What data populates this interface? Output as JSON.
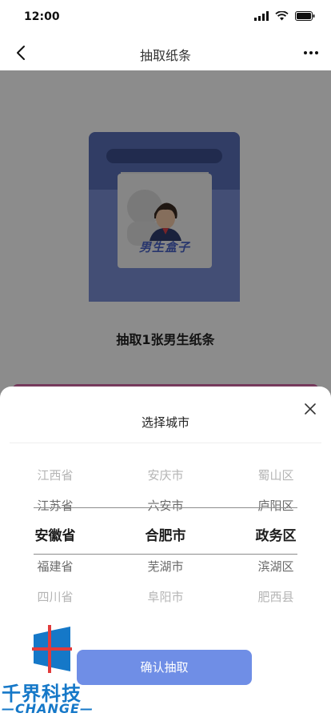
{
  "status_bar": {
    "time": "12:00"
  },
  "nav": {
    "title": "抽取纸条",
    "back_icon": "chevron-left-icon",
    "more_icon": "more-dots-icon"
  },
  "page": {
    "card_label": "男生盒子",
    "caption": "抽取1张男生纸条"
  },
  "sheet": {
    "title": "选择城市",
    "close_icon": "close-icon",
    "picker": {
      "provinces": [
        "江西省",
        "江苏省",
        "安徽省",
        "福建省",
        "四川省"
      ],
      "cities": [
        "安庆市",
        "六安市",
        "合肥市",
        "芜湖市",
        "阜阳市"
      ],
      "districts": [
        "蜀山区",
        "庐阳区",
        "政务区",
        "滨湖区",
        "肥西县"
      ],
      "selected_index": 2
    },
    "confirm_label": "确认抽取"
  },
  "watermark": {
    "cn": "千界科技",
    "en": "—CHANGE—"
  },
  "colors": {
    "accent": "#6f8ee6",
    "box_dark": "#5a6fb8",
    "box_light": "#7b8fd6",
    "watermark": "#1578c8"
  }
}
